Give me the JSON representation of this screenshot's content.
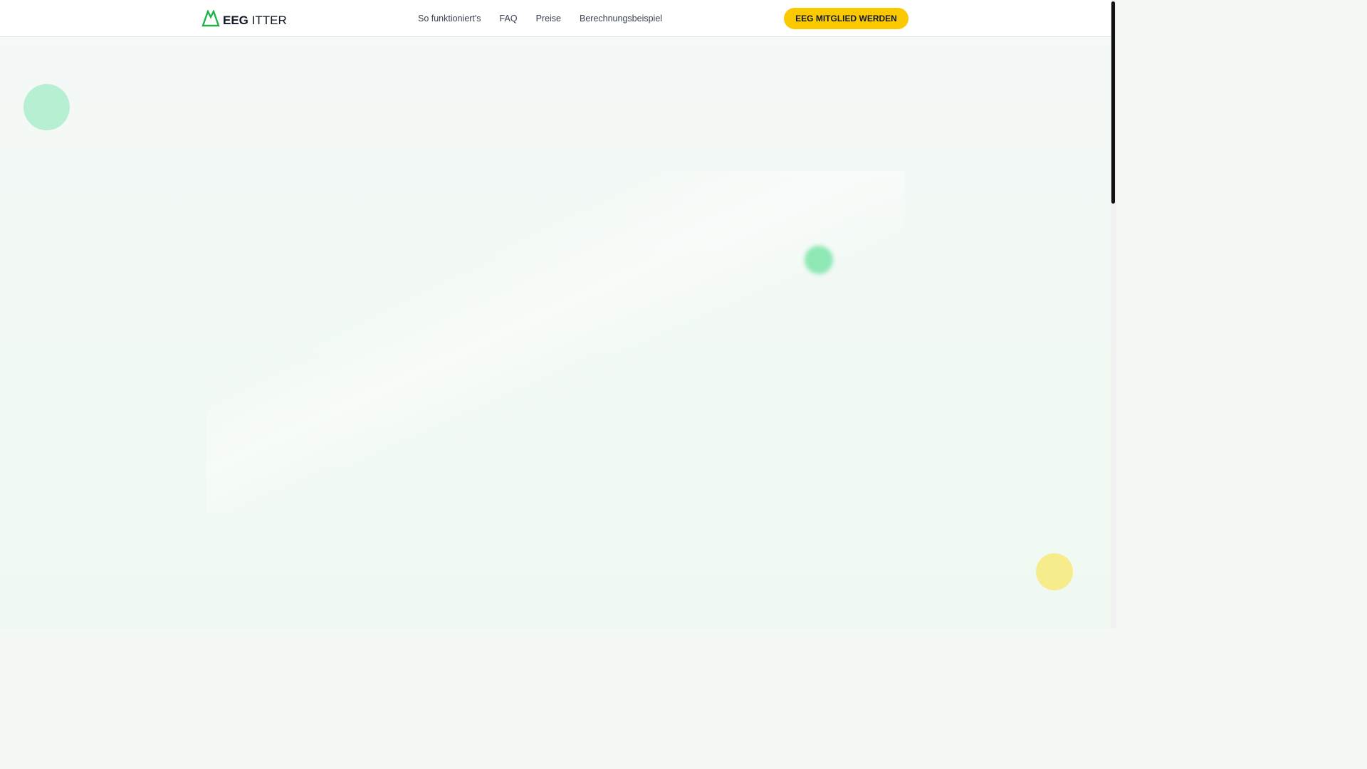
{
  "header": {
    "logo": {
      "bold": "EEG",
      "rest": "ITTER",
      "icon": "mountain-icon",
      "color": "#22b14c"
    },
    "nav": [
      {
        "label": "So funktioniert's"
      },
      {
        "label": "FAQ"
      },
      {
        "label": "Preise"
      },
      {
        "label": "Berechnungsbeispiel"
      }
    ],
    "cta_label": "EEG MITGLIED WERDEN",
    "cta_color": "#fbc900"
  }
}
